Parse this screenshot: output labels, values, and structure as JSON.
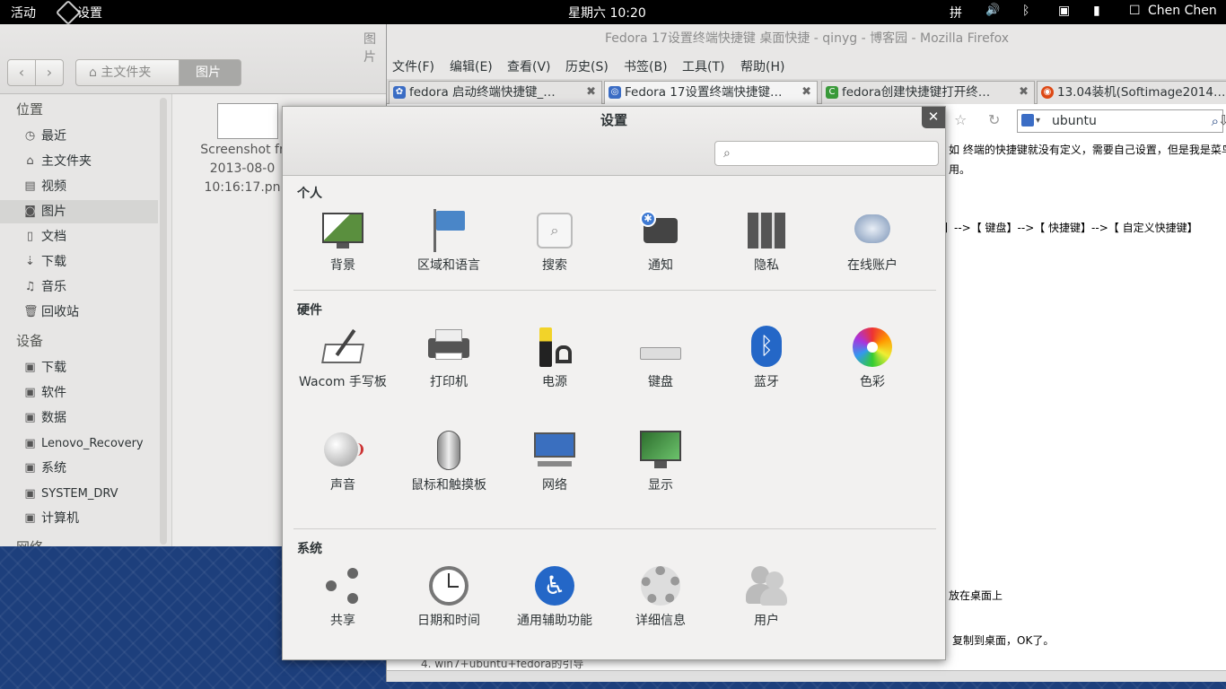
{
  "topbar": {
    "activities": "活动",
    "app": "设置",
    "clock": "星期六 10:20",
    "input": "拼",
    "user": "Chen Chen"
  },
  "files": {
    "title": "图片",
    "crumbs": [
      "主文件夹",
      "图片"
    ],
    "places_header": "位置",
    "places": [
      "最近",
      "主文件夹",
      "视频",
      "图片",
      "文档",
      "下载",
      "音乐",
      "回收站"
    ],
    "devices_header": "设备",
    "devices": [
      "下载",
      "软件",
      "数据",
      "Lenovo_Recovery",
      "系统",
      "SYSTEM_DRV",
      "计算机"
    ],
    "network_header": "网络",
    "file": {
      "line1": "Screenshot fr",
      "line2": "2013-08-0",
      "line3": "10:16:17.pn"
    }
  },
  "firefox": {
    "title": "Fedora 17设置终端快捷键 桌面快捷 - qinyg - 博客园 - Mozilla Firefox",
    "menu": [
      "文件(F)",
      "编辑(E)",
      "查看(V)",
      "历史(S)",
      "书签(B)",
      "工具(T)",
      "帮助(H)"
    ],
    "tabs": [
      "fedora 启动终端快捷键_…",
      "Fedora 17设置终端快捷键…",
      "fedora创建快捷键打开终…",
      "13.04装机(Softimage2014…"
    ],
    "search_value": "ubuntu",
    "page_lines": [
      "如 终端的快捷键就没有定义，需要自己设置，但是我是菜鸟",
      "用。",
      "】-->【 键盘】-->【 快捷键】-->【 自定义快捷键】",
      "放在桌面上",
      "复制到桌面，OK了。",
      "4. win7+ubuntu+fedora的引导"
    ]
  },
  "settings": {
    "title": "设置",
    "sections": [
      {
        "name": "个人",
        "items": [
          "背景",
          "区域和语言",
          "搜索",
          "通知",
          "隐私",
          "在线账户"
        ]
      },
      {
        "name": "硬件",
        "items": [
          "Wacom 手写板",
          "打印机",
          "电源",
          "键盘",
          "蓝牙",
          "色彩",
          "声音",
          "鼠标和触摸板",
          "网络",
          "显示"
        ]
      },
      {
        "name": "系统",
        "items": [
          "共享",
          "日期和时间",
          "通用辅助功能",
          "详细信息",
          "用户"
        ]
      }
    ]
  }
}
